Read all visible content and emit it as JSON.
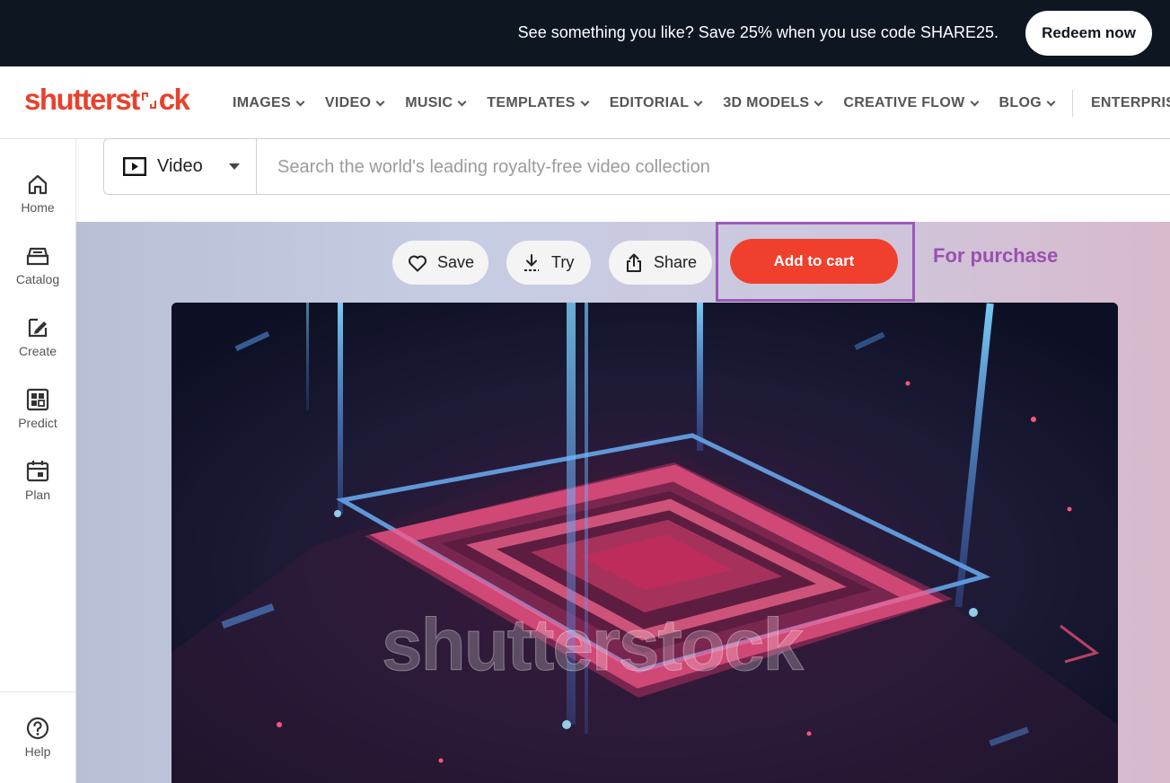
{
  "promo": {
    "text": "See something you like? Save 25% when you use code SHARE25.",
    "cta": "Redeem now"
  },
  "logo": {
    "text_a": "shutterst",
    "text_b": "ck"
  },
  "nav": {
    "items": [
      {
        "label": "IMAGES"
      },
      {
        "label": "VIDEO"
      },
      {
        "label": "MUSIC"
      },
      {
        "label": "TEMPLATES"
      },
      {
        "label": "EDITORIAL"
      },
      {
        "label": "3D MODELS"
      },
      {
        "label": "CREATIVE FLOW"
      },
      {
        "label": "BLOG"
      }
    ],
    "enterprise": "ENTERPRISE"
  },
  "sidebar": {
    "items": [
      {
        "label": "Home",
        "icon": "home-icon"
      },
      {
        "label": "Catalog",
        "icon": "catalog-icon"
      },
      {
        "label": "Create",
        "icon": "create-icon"
      },
      {
        "label": "Predict",
        "icon": "predict-icon"
      },
      {
        "label": "Plan",
        "icon": "plan-icon"
      }
    ],
    "help": {
      "label": "Help",
      "icon": "help-icon"
    }
  },
  "search": {
    "type_label": "Video",
    "placeholder": "Search the world's leading royalty-free video collection"
  },
  "actions": {
    "save": "Save",
    "try": "Try",
    "share": "Share",
    "add_to_cart": "Add to cart"
  },
  "annotation": "For purchase",
  "video": {
    "watermark": "shutterstock"
  },
  "colors": {
    "brand": "#e8412c",
    "cart_button": "#f0402d",
    "highlight": "#9b59b6",
    "promo_bg": "#0e1621"
  }
}
